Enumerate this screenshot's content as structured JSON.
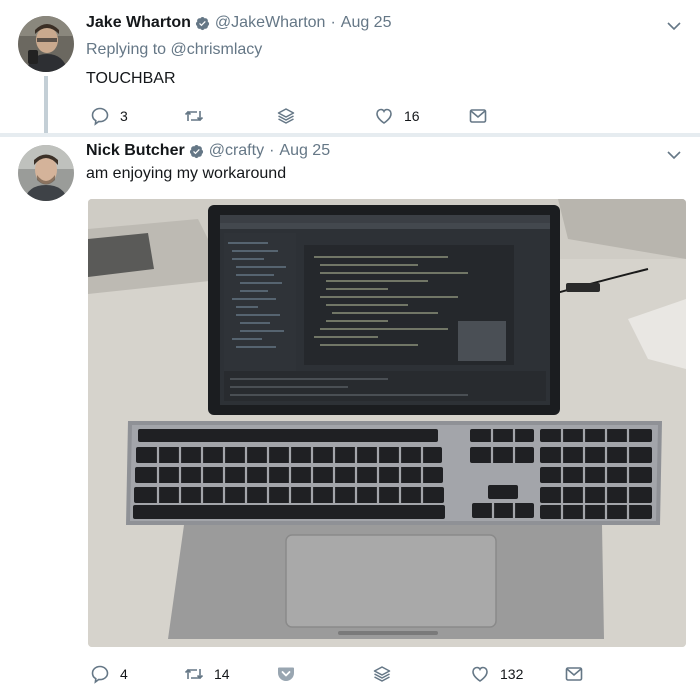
{
  "tweet1": {
    "author": {
      "name": "Jake Wharton",
      "handle": "@JakeWharton",
      "separator": "·",
      "date": "Aug 25"
    },
    "reply_prefix": "Replying to",
    "reply_mention": "@chrismlacy",
    "text": "TOUCHBAR",
    "actions": {
      "replies": "3",
      "retweets": "",
      "likes": "16"
    }
  },
  "tweet2": {
    "author": {
      "name": "Nick Butcher",
      "handle": "@crafty",
      "separator": "·",
      "date": "Aug 25"
    },
    "text": "am enjoying my workaround",
    "actions": {
      "replies": "4",
      "retweets": "14",
      "likes": "132"
    }
  },
  "icons": [
    "verified-icon",
    "chevron-down-icon",
    "reply-icon",
    "retweet-icon",
    "layers-icon",
    "like-icon",
    "message-icon",
    "pocket-icon"
  ],
  "colors": {
    "verified": "#1da1f2",
    "muted": "#657786",
    "pocket": "#99a6b1",
    "thread_line": "#c4cfd6"
  }
}
